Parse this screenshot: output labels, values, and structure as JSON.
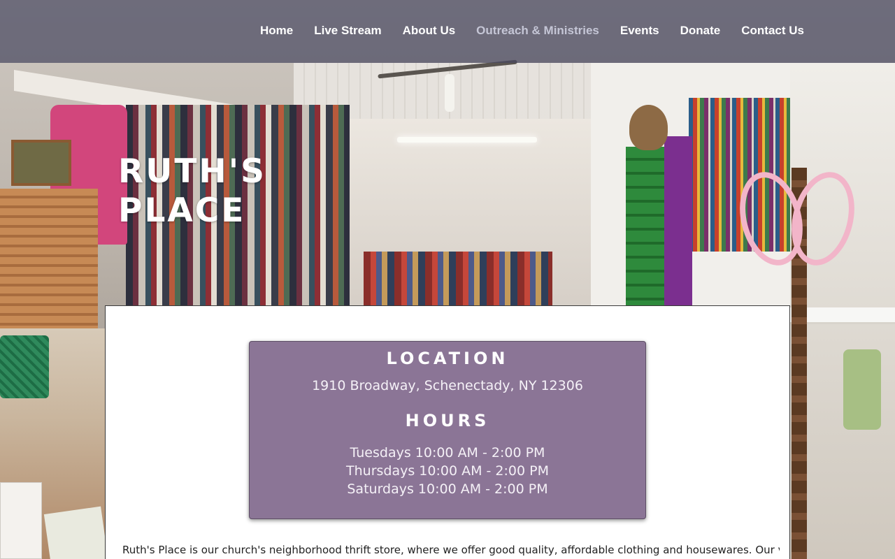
{
  "colors": {
    "header_bg": "#484860",
    "nav_text": "#ffffff",
    "nav_active_text": "#c5c6d6",
    "info_box_bg": "#8b7596",
    "panel_bg": "#ffffff"
  },
  "nav": {
    "items": [
      {
        "label": "Home",
        "active": false
      },
      {
        "label": "Live Stream",
        "active": false
      },
      {
        "label": "About Us",
        "active": false
      },
      {
        "label": "Outreach & Ministries",
        "active": true
      },
      {
        "label": "Events",
        "active": false
      },
      {
        "label": "Donate",
        "active": false
      },
      {
        "label": "Contact Us",
        "active": false
      }
    ]
  },
  "hero": {
    "title_line1": "Ruth's",
    "title_line2": "Place"
  },
  "info": {
    "location_heading": "Location",
    "address": "1910 Broadway, Schenectady, NY 12306",
    "hours_heading": "Hours",
    "hours": [
      "Tuesdays 10:00 AM - 2:00 PM",
      "Thursdays 10:00 AM - 2:00 PM",
      "Saturdays 10:00 AM - 2:00 PM"
    ]
  },
  "intro_text": "Ruth's Place is our church's neighborhood thrift store, where we offer good quality, affordable clothing and housewares. Our vision for Ruth's"
}
